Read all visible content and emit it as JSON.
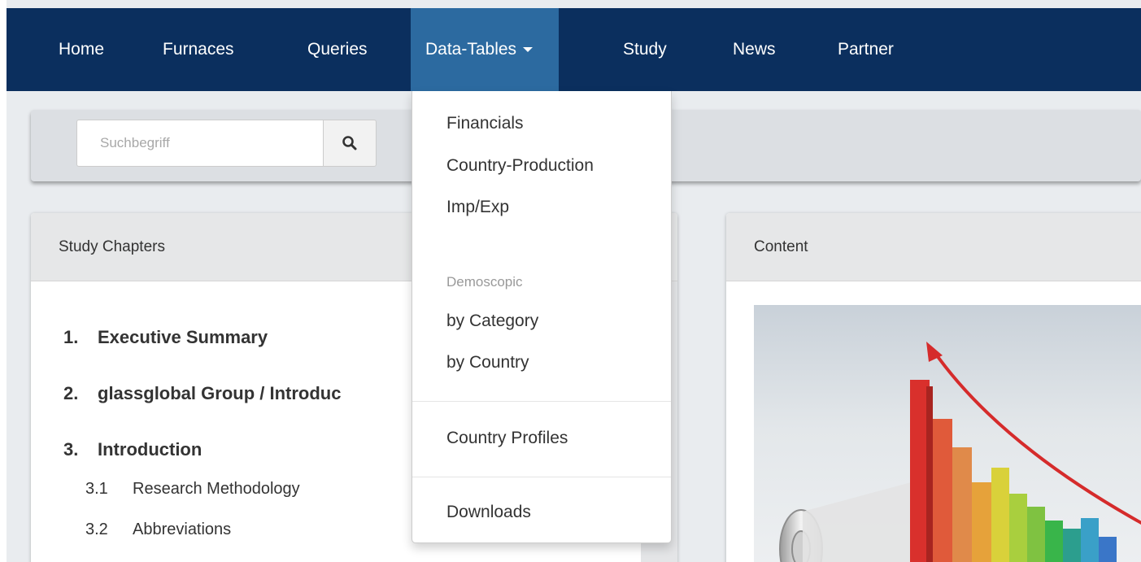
{
  "navbar": {
    "items": [
      {
        "label": "Home"
      },
      {
        "label": "Furnaces"
      },
      {
        "label": "Queries"
      },
      {
        "label": "Data-Tables"
      },
      {
        "label": "Study"
      },
      {
        "label": "News"
      },
      {
        "label": "Partner"
      }
    ],
    "active_item": "Data-Tables"
  },
  "search": {
    "placeholder": "Suchbegriff",
    "button_icon": "search-icon"
  },
  "dropdown": {
    "items": [
      {
        "label": "Financials"
      },
      {
        "label": "Country-Production"
      },
      {
        "label": "Imp/Exp"
      }
    ],
    "header": "Demoscopic",
    "demoscopic_items": [
      {
        "label": "by Category"
      },
      {
        "label": "by Country"
      }
    ],
    "country_profiles": "Country Profiles",
    "downloads": "Downloads"
  },
  "chapters_panel": {
    "title": "Study Chapters",
    "chapters": [
      {
        "num": "1.",
        "label": "Executive Summary"
      },
      {
        "num": "2.",
        "label": "glassglobal Group / Introduc"
      },
      {
        "num": "3.",
        "label": "Introduction"
      }
    ],
    "subchapters": [
      {
        "num": "3.1",
        "label": "Research Methodology"
      },
      {
        "num": "3.2",
        "label": "Abbreviations"
      }
    ]
  },
  "content_panel": {
    "title": "Content",
    "image_icon": "growth-chart-illustration"
  },
  "colors": {
    "navbar_bg": "#0b2f5e",
    "navbar_active": "#2c6aa0",
    "page_bg": "#e9ecef",
    "bars": [
      "#d9302c",
      "#e05a3a",
      "#e6a23a",
      "#d9d13a",
      "#7fc241",
      "#39b54a",
      "#2c9e8e",
      "#3aa0c8"
    ]
  }
}
